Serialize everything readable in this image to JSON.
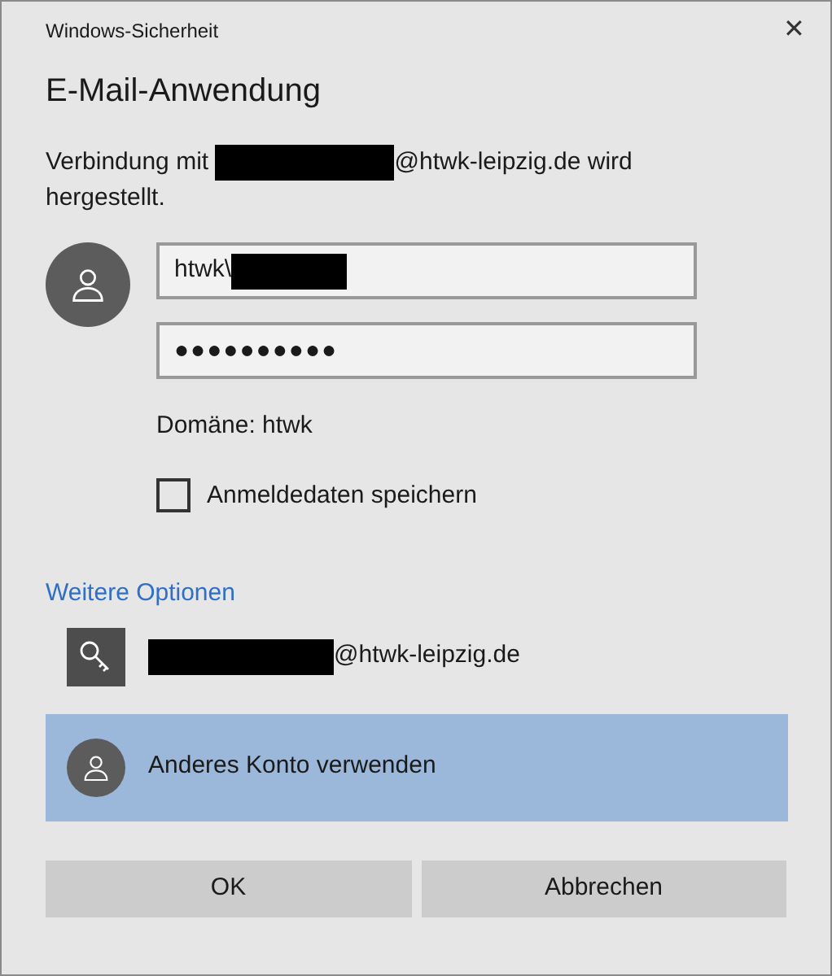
{
  "window": {
    "title": "Windows-Sicherheit",
    "close": "✕"
  },
  "heading": "E-Mail-Anwendung",
  "message": {
    "before": "Verbindung mit",
    "redacted": true,
    "after": "@htwk-leipzig.de wird",
    "continued": "hergestellt."
  },
  "username": {
    "value": "htwk\\",
    "redacted": true
  },
  "password": {
    "value": "●●●●●●●●●●"
  },
  "domain": "Domäne: htwk",
  "remember": {
    "label": "Anmeldedaten speichern",
    "checked": false
  },
  "more_options": "Weitere Optionen",
  "accounts": [
    {
      "kind": "key",
      "label": "@htwk-leipzig.de",
      "redacted": true,
      "selected": false
    },
    {
      "kind": "person",
      "label": "Anderes Konto verwenden",
      "redacted": false,
      "selected": true
    }
  ],
  "buttons": [
    "OK",
    "Abbrechen"
  ]
}
